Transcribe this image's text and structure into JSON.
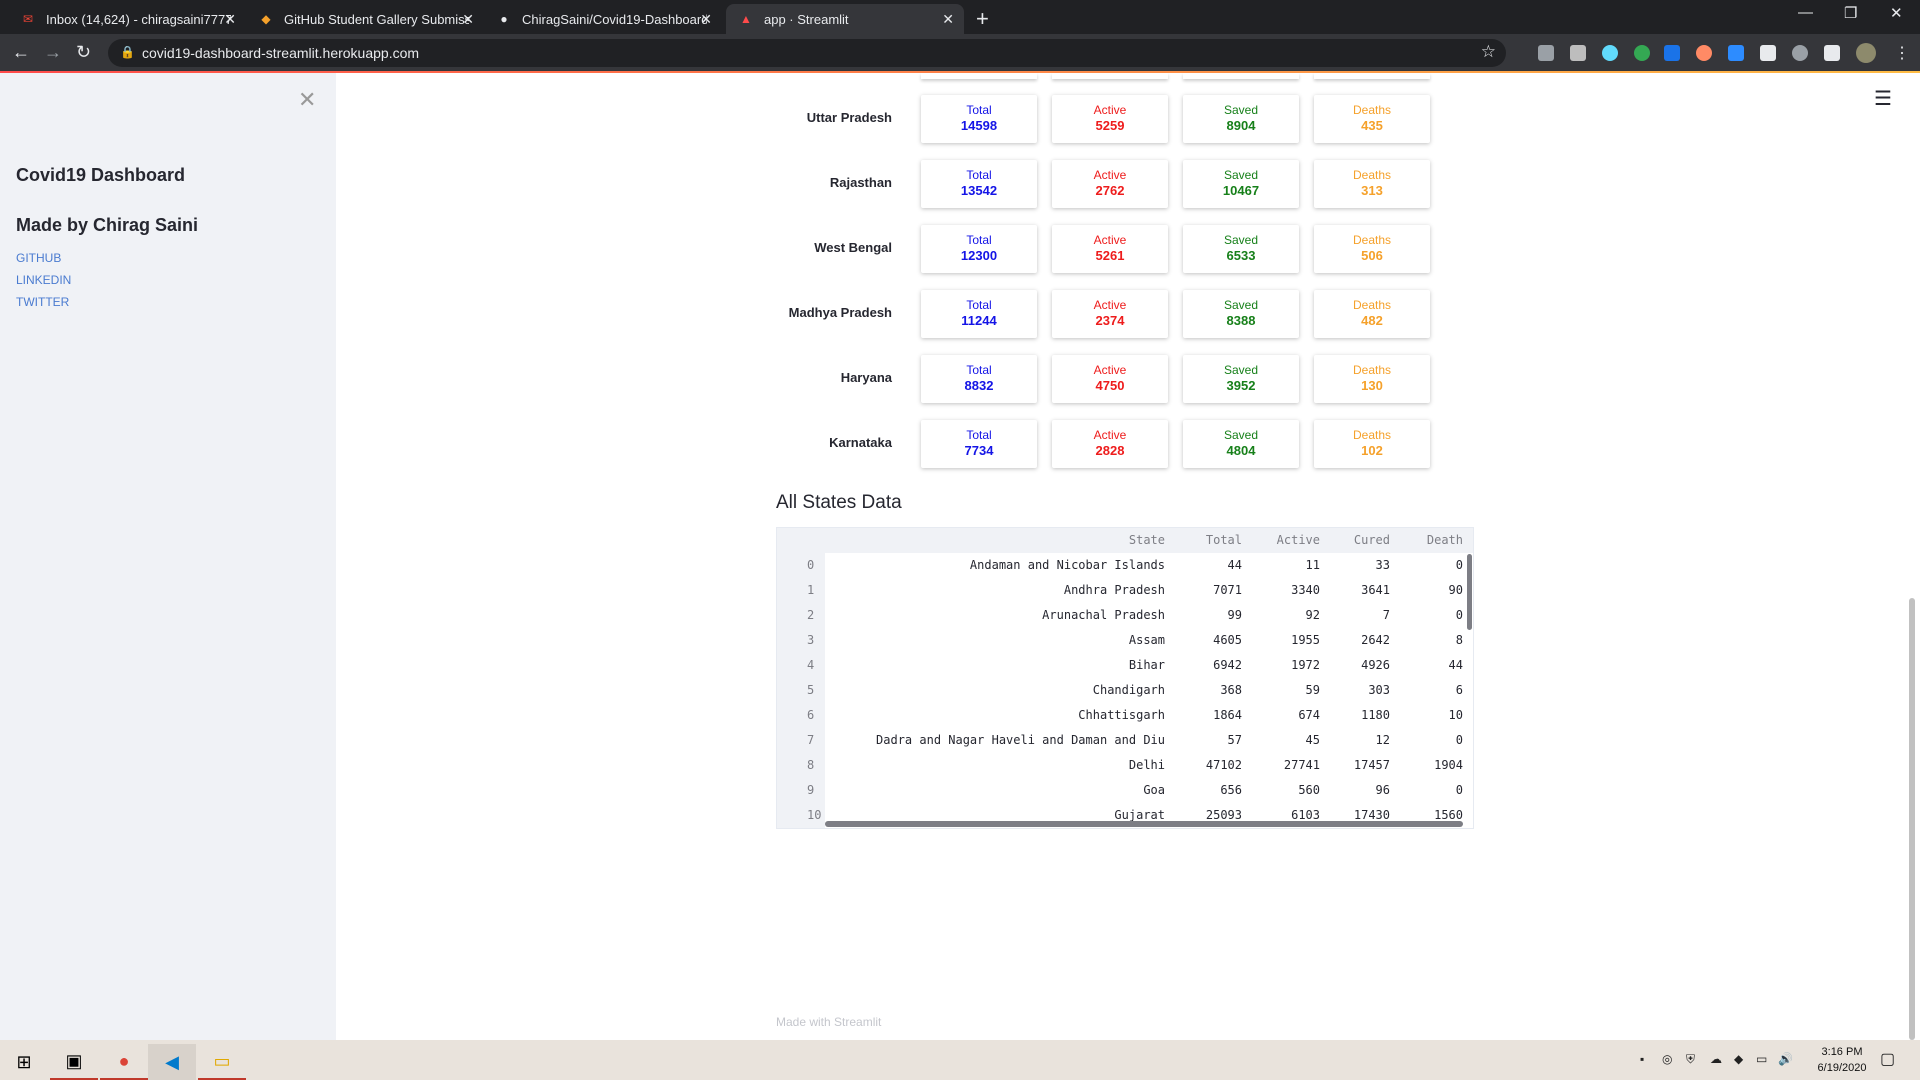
{
  "browser": {
    "tabs": [
      {
        "title": "Inbox (14,624) - chiragsaini7777@",
        "icon": "gmail-icon",
        "active": false
      },
      {
        "title": "GitHub Student Gallery Submissi",
        "icon": "github-gallery-icon",
        "active": false
      },
      {
        "title": "ChiragSaini/Covid19-Dashboard",
        "icon": "github-icon",
        "active": false
      },
      {
        "title": "app · Streamlit",
        "icon": "streamlit-icon",
        "active": true
      }
    ],
    "url": "covid19-dashboard-streamlit.herokuapp.com"
  },
  "sidebar": {
    "title": "Covid19 Dashboard",
    "subtitle": "Made by Chirag Saini",
    "links": [
      "GITHUB",
      "LINKEDIN",
      "TWITTER"
    ]
  },
  "labels": {
    "total": "Total",
    "active": "Active",
    "saved": "Saved",
    "deaths": "Deaths"
  },
  "states": [
    {
      "name": "Uttar Pradesh",
      "total": "14598",
      "active": "5259",
      "saved": "8904",
      "deaths": "435"
    },
    {
      "name": "Rajasthan",
      "total": "13542",
      "active": "2762",
      "saved": "10467",
      "deaths": "313"
    },
    {
      "name": "West Bengal",
      "total": "12300",
      "active": "5261",
      "saved": "6533",
      "deaths": "506"
    },
    {
      "name": "Madhya Pradesh",
      "total": "11244",
      "active": "2374",
      "saved": "8388",
      "deaths": "482"
    },
    {
      "name": "Haryana",
      "total": "8832",
      "active": "4750",
      "saved": "3952",
      "deaths": "130"
    },
    {
      "name": "Karnataka",
      "total": "7734",
      "active": "2828",
      "saved": "4804",
      "deaths": "102"
    }
  ],
  "table": {
    "title": "All States Data",
    "columns": [
      "State",
      "Total",
      "Active",
      "Cured",
      "Death"
    ],
    "rows": [
      [
        "0",
        "Andaman and Nicobar Islands",
        "44",
        "11",
        "33",
        "0"
      ],
      [
        "1",
        "Andhra Pradesh",
        "7071",
        "3340",
        "3641",
        "90"
      ],
      [
        "2",
        "Arunachal Pradesh",
        "99",
        "92",
        "7",
        "0"
      ],
      [
        "3",
        "Assam",
        "4605",
        "1955",
        "2642",
        "8"
      ],
      [
        "4",
        "Bihar",
        "6942",
        "1972",
        "4926",
        "44"
      ],
      [
        "5",
        "Chandigarh",
        "368",
        "59",
        "303",
        "6"
      ],
      [
        "6",
        "Chhattisgarh",
        "1864",
        "674",
        "1180",
        "10"
      ],
      [
        "7",
        "Dadra and Nagar Haveli and Daman and Diu",
        "57",
        "45",
        "12",
        "0"
      ],
      [
        "8",
        "Delhi",
        "47102",
        "27741",
        "17457",
        "1904"
      ],
      [
        "9",
        "Goa",
        "656",
        "560",
        "96",
        "0"
      ],
      [
        "10",
        "Gujarat",
        "25093",
        "6103",
        "17430",
        "1560"
      ]
    ]
  },
  "footer": "Made with Streamlit",
  "taskbar": {
    "time": "3:16 PM",
    "date": "6/19/2020"
  }
}
